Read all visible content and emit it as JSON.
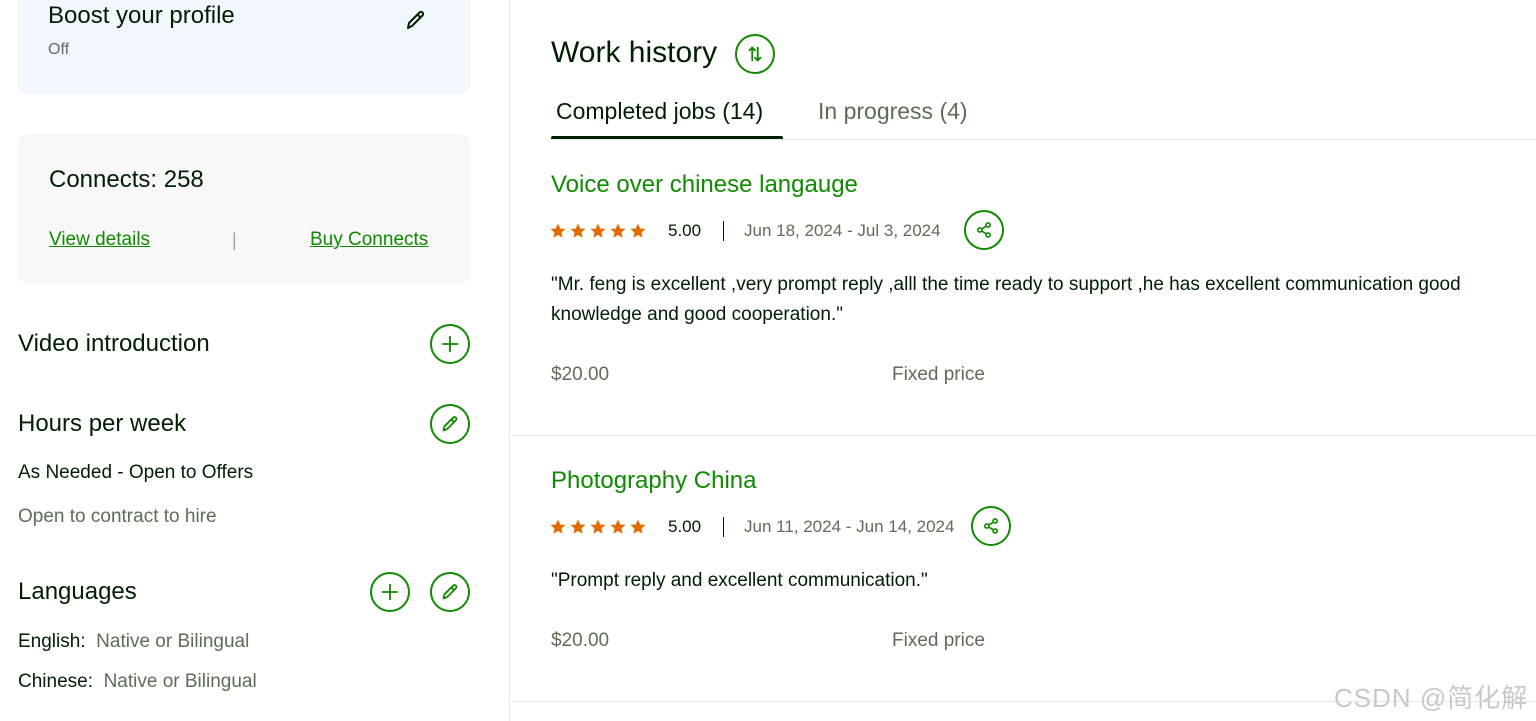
{
  "boost": {
    "title": "Boost your profile",
    "status": "Off"
  },
  "connects": {
    "title": "Connects: 258",
    "view_details": "View details",
    "divider": "|",
    "buy": "Buy Connects"
  },
  "video": {
    "title": "Video introduction"
  },
  "hours": {
    "title": "Hours per week",
    "value": "As Needed - Open to Offers",
    "contract": "Open to contract to hire"
  },
  "languages": {
    "title": "Languages",
    "items": [
      {
        "name": "English:",
        "level": "Native or Bilingual"
      },
      {
        "name": "Chinese:",
        "level": "Native or Bilingual"
      }
    ]
  },
  "work_history": {
    "title": "Work history",
    "tabs": [
      {
        "label": "Completed jobs (14)",
        "active": true
      },
      {
        "label": "In progress (4)",
        "active": false
      }
    ],
    "jobs": [
      {
        "title": "Voice over chinese langauge",
        "rating": "5.00",
        "stars": 5,
        "dates": "Jun 18, 2024 - Jul 3, 2024",
        "review": "\"Mr. feng is excellent ,very prompt reply ,alll the time ready to support ,he has excellent communication good knowledge and good cooperation.\"",
        "price": "$20.00",
        "price_type": "Fixed price"
      },
      {
        "title": "Photography China",
        "rating": "5.00",
        "stars": 5,
        "dates": "Jun 11, 2024 - Jun 14, 2024",
        "review": "\"Prompt reply and excellent communication.\"",
        "price": "$20.00",
        "price_type": "Fixed price"
      }
    ]
  },
  "watermark": "CSDN @简化解",
  "colors": {
    "accent": "#108a00",
    "star": "#e06b00",
    "text": "#001e00",
    "muted": "#5e6d55",
    "boost_bg": "#f2f7fe",
    "card_bg": "#f8f8f8"
  }
}
